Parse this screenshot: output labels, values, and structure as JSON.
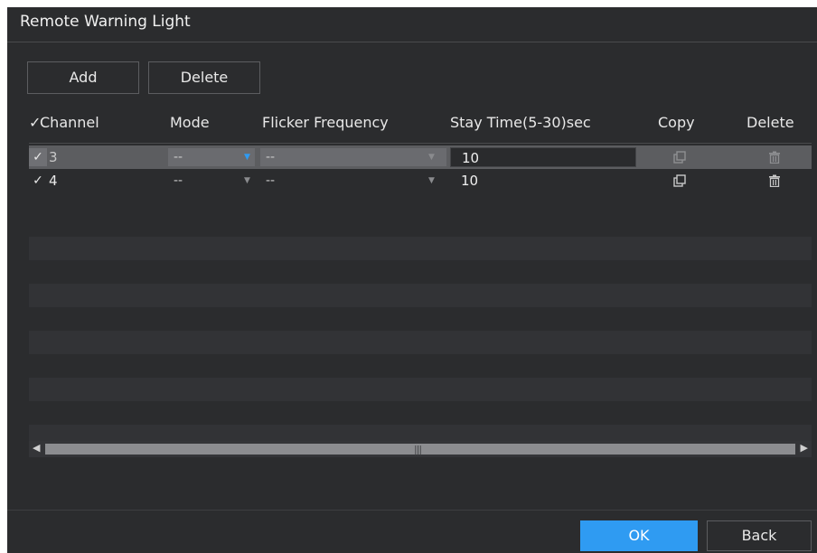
{
  "dialog": {
    "title": "Remote Warning Light"
  },
  "toolbar": {
    "add_label": "Add",
    "delete_label": "Delete"
  },
  "table": {
    "headers": {
      "check": "✓",
      "channel": "Channel",
      "mode": "Mode",
      "flicker": "Flicker Frequency",
      "stay": "Stay Time(5-30)sec",
      "copy": "Copy",
      "delete": "Delete"
    },
    "rows": [
      {
        "checked": "✓",
        "channel": "3",
        "mode": "--",
        "flicker": "--",
        "stay_time": "10",
        "selected": true
      },
      {
        "checked": "✓",
        "channel": "4",
        "mode": "--",
        "flicker": "--",
        "stay_time": "10",
        "selected": false
      }
    ]
  },
  "footer": {
    "ok_label": "OK",
    "back_label": "Back"
  },
  "colors": {
    "accent": "#2f9bf2",
    "background": "#2b2c2e",
    "selected_row": "#5c5d60"
  },
  "icons": {
    "copy": "copy-icon",
    "delete": "trash-icon",
    "dropdown": "caret-down-icon"
  }
}
